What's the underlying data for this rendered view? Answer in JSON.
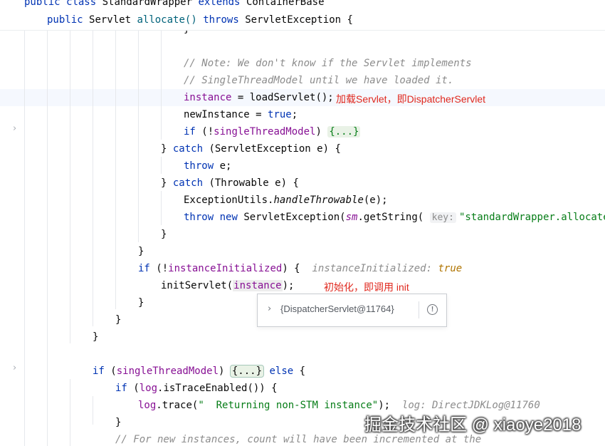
{
  "sticky": {
    "class_line": {
      "kw1": "public",
      "kw2": "class",
      "name": "StandardWrapper",
      "kw3": "extends",
      "parent": "ContainerBase"
    },
    "method_line": {
      "kw1": "public",
      "type": "Servlet",
      "name": "allocate()",
      "kw2": "throws",
      "exc": "ServletException {"
    }
  },
  "code": {
    "close_brace_top": "}",
    "comment1": "// Note: We don't know if the Servlet implements",
    "comment2": "// SingleThreadModel until we have loaded it.",
    "instance_field": "instance",
    "assign_load": " = loadServlet();",
    "note_load": "加载Servlet，即DispatcherServlet",
    "newinstance": "newInstance = ",
    "true_kw": "true",
    "semicolon": ";",
    "if_kw": "if",
    "open_paren_not": " (!",
    "stm_field": "singleThreadModel",
    "close_paren": ") ",
    "fold_marker": "{...}",
    "close_catch_brace": "} ",
    "catch_kw": "catch",
    "catch1_rest": " (ServletException e) {",
    "throw_kw": "throw",
    "throw_e": " e;",
    "catch2_rest": " (Throwable e) {",
    "exutils": "ExceptionUtils.",
    "handle": "handleThrowable",
    "handle_rest": "(e);",
    "new_kw": "new",
    "servlet_exc": " ServletException(",
    "sm": "sm",
    "getstring": ".getString(",
    "param_key": "key:",
    "alloc_string": "\"standardWrapper.allocate\"",
    "alloc_tail": "), (",
    "brace": "}",
    "inst_init_field": "instanceInitialized",
    "open_brace_tail": ") {",
    "hint_inst_init": "instanceInitialized:",
    "hint_true": "true",
    "init_servlet": "initServlet(",
    "init_tail": ");",
    "note_init": "初始化，即调用 init",
    "else_kw": "else",
    "open_paren": " (",
    "log_field": "log",
    "is_trace": ".isTraceEnabled()) {",
    "log_trace": ".trace(",
    "returning_str": "\"  Returning non-STM instance\"",
    "hint_log": "log: DirectJDKLog@11760",
    "comment_bottom": "// For new instances, count will have been incremented at the"
  },
  "popup": {
    "value": "{DispatcherServlet@11764}",
    "expand_icon": "chevron-right-icon",
    "info_icon": "exclamation-circle-icon",
    "info_glyph": "!"
  },
  "watermark": "掘金技术社区 @ xiaoye2018",
  "gutter": {
    "chevron": "›"
  }
}
